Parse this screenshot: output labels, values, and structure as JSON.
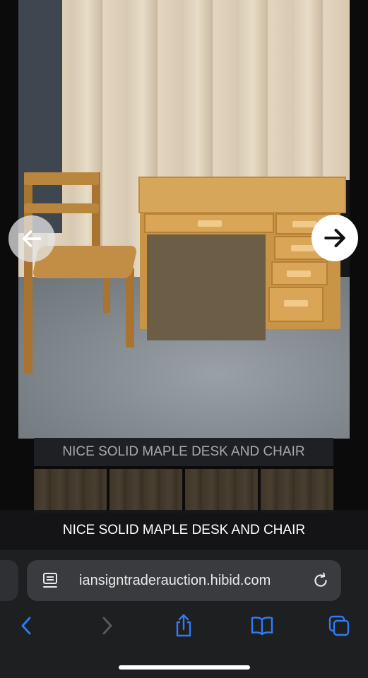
{
  "listing": {
    "caption_background": "NICE SOLID MAPLE DESK AND CHAIR",
    "caption_overlay": "NICE SOLID MAPLE DESK AND CHAIR"
  },
  "browser": {
    "url": "iansigntraderauction.hibid.com"
  },
  "icons": {
    "prev": "arrow-left-icon",
    "next": "arrow-right-icon",
    "site": "page-icon",
    "reload": "reload-icon",
    "back": "chevron-left-icon",
    "forward": "chevron-right-icon",
    "share": "share-icon",
    "bookmarks": "book-icon",
    "tabs": "tabs-icon"
  },
  "colors": {
    "accent": "#2f7cf6",
    "disabled": "#5a5b5e"
  }
}
